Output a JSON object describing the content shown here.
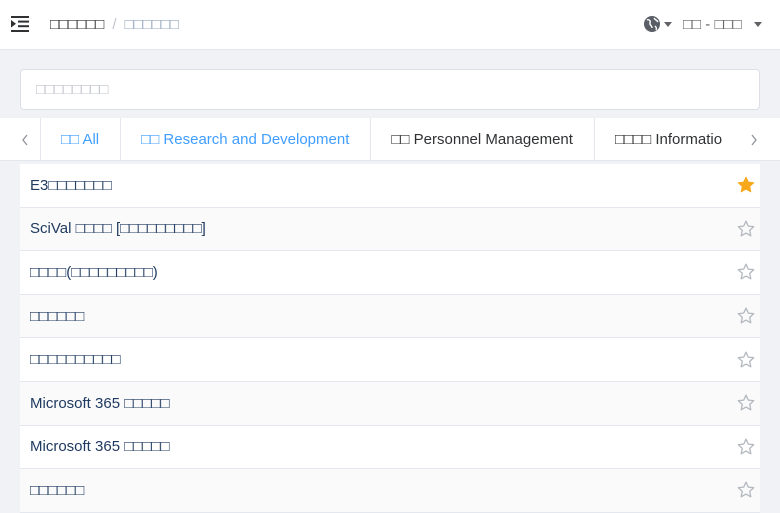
{
  "header": {
    "breadcrumb": [
      "□□□□□□",
      "□□□□□□"
    ],
    "breadcrumb_sep": "/",
    "user_label": "□□ - □□□"
  },
  "search": {
    "placeholder": "□□□□□□□□"
  },
  "tabs": [
    {
      "label": "□□ All",
      "active": true
    },
    {
      "label": "□□ Research and Development",
      "active": false
    },
    {
      "label": "□□ Personnel Management",
      "active": false
    },
    {
      "label": "□□□□ Informatio",
      "active": false
    }
  ],
  "services": [
    {
      "label": "E3□□□□□□□",
      "favorite": true
    },
    {
      "label": "SciVal □□□□ [□□□□□□□□□]",
      "favorite": false
    },
    {
      "label": "□□□□(□□□□□□□□□)",
      "favorite": false
    },
    {
      "label": "□□□□□□",
      "favorite": false
    },
    {
      "label": "□□□□□□□□□□",
      "favorite": false
    },
    {
      "label": "Microsoft 365 □□□□□",
      "favorite": false
    },
    {
      "label": "Microsoft 365 □□□□□",
      "favorite": false
    },
    {
      "label": "□□□□□□",
      "favorite": false
    }
  ],
  "colors": {
    "accent": "#409eff",
    "star_on": "#f7a81b",
    "star_off": "#b4b8bf",
    "link_text": "#1f3a60"
  },
  "icons": {
    "menu": "indent-icon",
    "language": "globe-icon",
    "favorite": "star-icon"
  }
}
